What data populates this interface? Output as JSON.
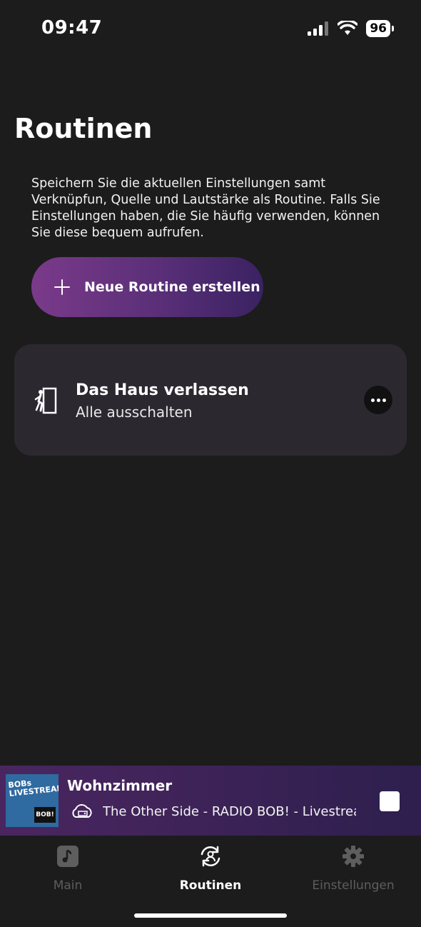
{
  "status_bar": {
    "time": "09:47",
    "battery": "96"
  },
  "page": {
    "title": "Routinen",
    "description": "Speichern Sie die aktuellen Einstellungen samt Verknüpfun, Quelle und Lautstärke als Routine. Falls Sie Einstellungen haben, die Sie häufig verwenden, können Sie diese bequem aufrufen.",
    "new_routine_label": "Neue Routine erstellen"
  },
  "routines": [
    {
      "title": "Das Haus verlassen",
      "subtitle": "Alle ausschalten",
      "icon": "door-exit-icon"
    }
  ],
  "player": {
    "room": "Wohnzimmer",
    "track": "The Other Side - RADIO BOB! - Livestream",
    "art_text": "BOBs LIVESTREAM",
    "art_logo": "BOB!"
  },
  "tabs": [
    {
      "label": "Main",
      "icon": "music-note-icon",
      "active": false
    },
    {
      "label": "Routinen",
      "icon": "routine-icon",
      "active": true
    },
    {
      "label": "Einstellungen",
      "icon": "gear-icon",
      "active": false
    }
  ],
  "colors": {
    "background": "#1c1c1c",
    "card": "#2c2830",
    "accent_start": "#7a3a8a",
    "accent_end": "#3a2262"
  }
}
